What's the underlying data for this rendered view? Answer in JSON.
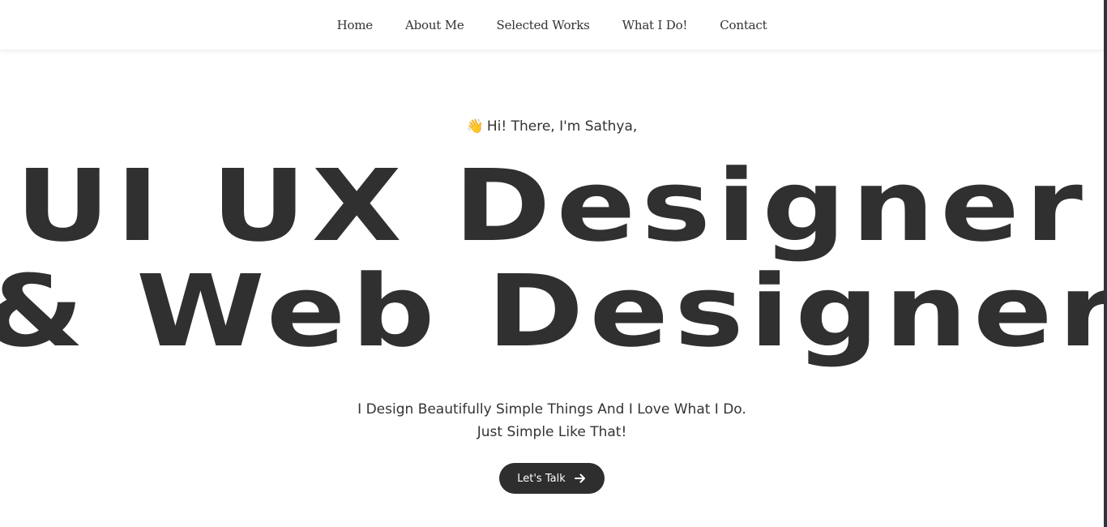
{
  "nav": {
    "items": [
      "Home",
      "About Me",
      "Selected Works",
      "What I Do!",
      "Contact"
    ]
  },
  "hero": {
    "wave_emoji": "👋",
    "greeting": "Hi! There, I'm Sathya,",
    "headline_line1": "UI UX Designer",
    "headline_line2": "& Web Designer",
    "tagline_line1": "I Design Beautifully Simple Things And I Love What I Do.",
    "tagline_line2": "Just Simple Like That!",
    "cta_label": "Let's Talk",
    "cta_icon": "arrow-right-icon"
  },
  "colors": {
    "background": "#ffffff",
    "text": "#333333",
    "headline": "#303030",
    "button": "#2e2e2e",
    "button_text": "#ffffff"
  }
}
